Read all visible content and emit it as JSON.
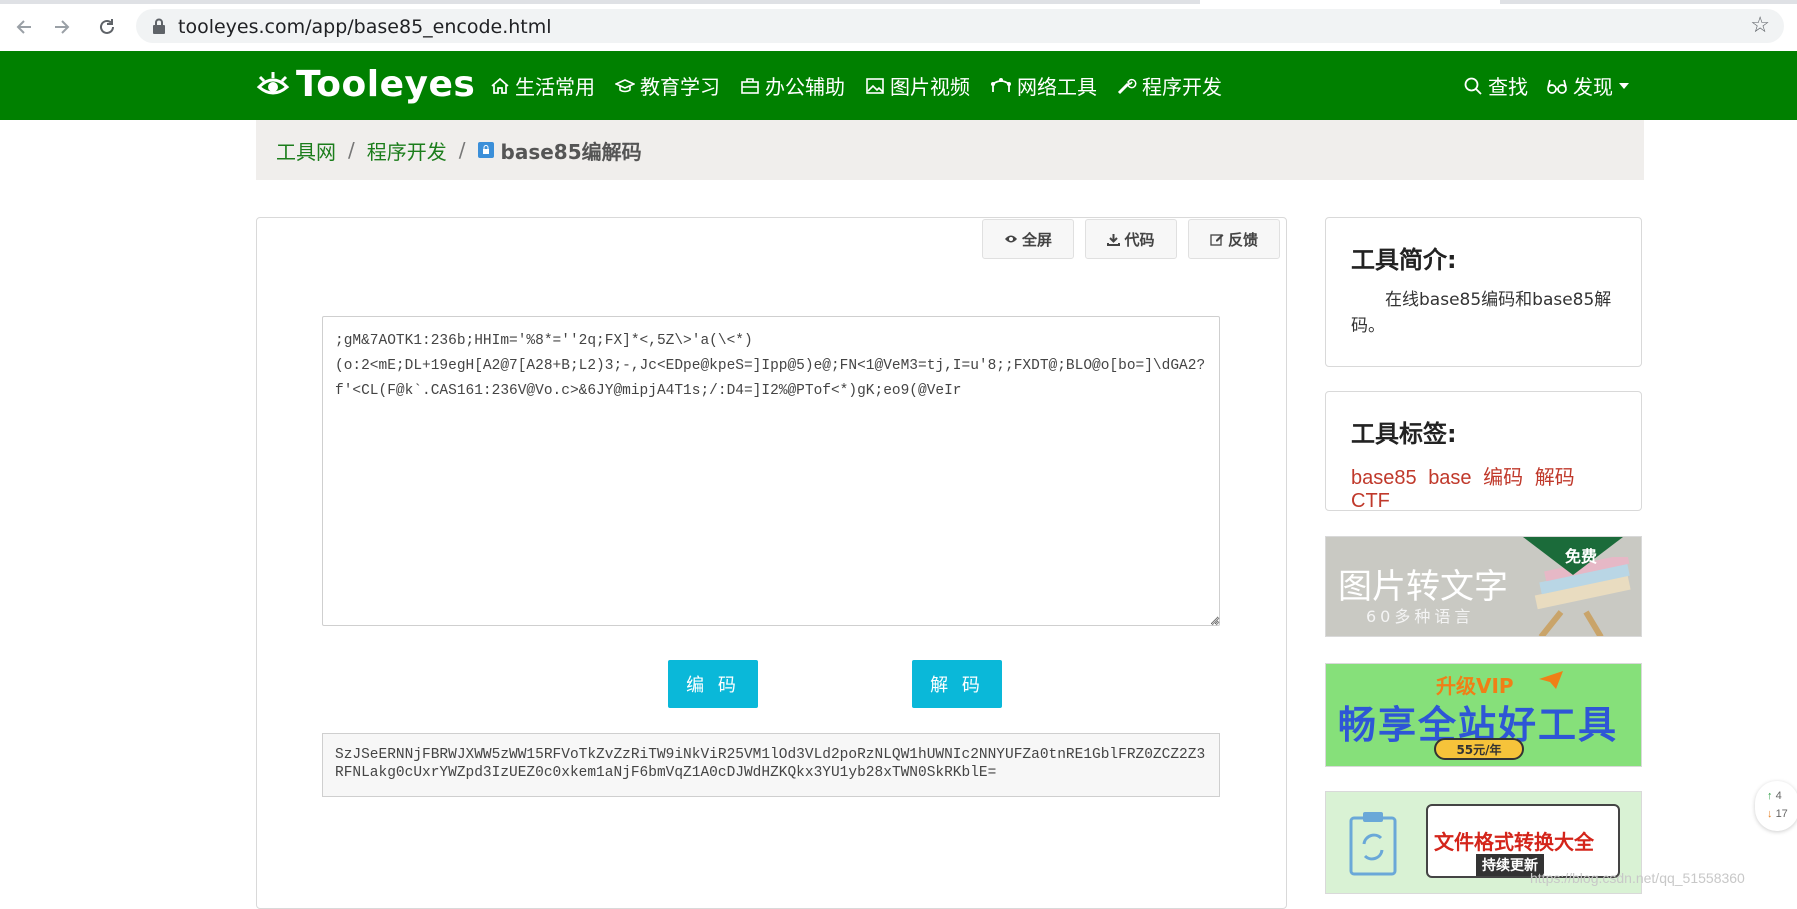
{
  "browser": {
    "url": "tooleyes.com/app/base85_encode.html"
  },
  "site": {
    "logo": "Tooleyes",
    "nav": [
      {
        "label": "生活常用",
        "icon": "home-icon"
      },
      {
        "label": "教育学习",
        "icon": "graduation-cap-icon"
      },
      {
        "label": "办公辅助",
        "icon": "briefcase-icon"
      },
      {
        "label": "图片视频",
        "icon": "image-icon"
      },
      {
        "label": "网络工具",
        "icon": "network-icon"
      },
      {
        "label": "程序开发",
        "icon": "wrench-icon"
      }
    ],
    "search": "查找",
    "discover": "发现"
  },
  "breadcrumb": {
    "home": "工具网",
    "category": "程序开发",
    "current": "base85编解码"
  },
  "toolbar": {
    "fullscreen": "全屏",
    "code": "代码",
    "feedback": "反馈"
  },
  "tool": {
    "input_text": ";gM&7AOTK1:236b;HHIm='%8*=''2q;FX]*<,5Z\\>'a(\\<*)\n(o:2<mE;DL+19egH[A2@7[A28+B;L2)3;-,Jc<EDpe@kpeS=]Ipp@5)e@;FN<1@VeM3=tj,I=u'8;;FXDT@;BLO@o[bo=]\\dGA2?f'<CL(F@k`.CAS161:236V@Vo.c>&6JY@mipjA4T1s;/:D4=]I2%@PTof<*)gK;eo9(@VeIr",
    "encode": "编 码",
    "decode": "解 码",
    "output_text": "SzJSeERNNjFBRWJXWW5zWW15RFVoTkZvZzRiTW9iNkViR25VM1lOd3VLd2poRzNLQW1hUWNIc2NNYUFZa0tnRE1GblFRZ0ZCZ2Z3RFNLakg0cUxrYWZpd3IzUEZ0c0xkem1aNjF6bmVqZ1A0cDJWdHZKQkx3YU1yb28xTWN0SkRKblE="
  },
  "sidebar": {
    "intro_title": "工具简介:",
    "intro_text": "在线base85编码和base85解码。",
    "tags_title": "工具标签:",
    "tags": [
      "base85",
      "base",
      "编码",
      "解码",
      "CTF"
    ]
  },
  "ads": {
    "ad1_title": "图片转文字",
    "ad1_sub": "60多种语言",
    "ad1_badge": "免费",
    "ad2_top": "升级VIP",
    "ad2_title": "畅享全站好工具",
    "ad2_price": "55元/年",
    "ad3_title": "文件格式转换大全",
    "ad3_sub": "持续更新"
  },
  "float_widget": {
    "up": "4",
    "down": "17"
  },
  "watermark": "https://blog.csdn.net/qq_51558360"
}
